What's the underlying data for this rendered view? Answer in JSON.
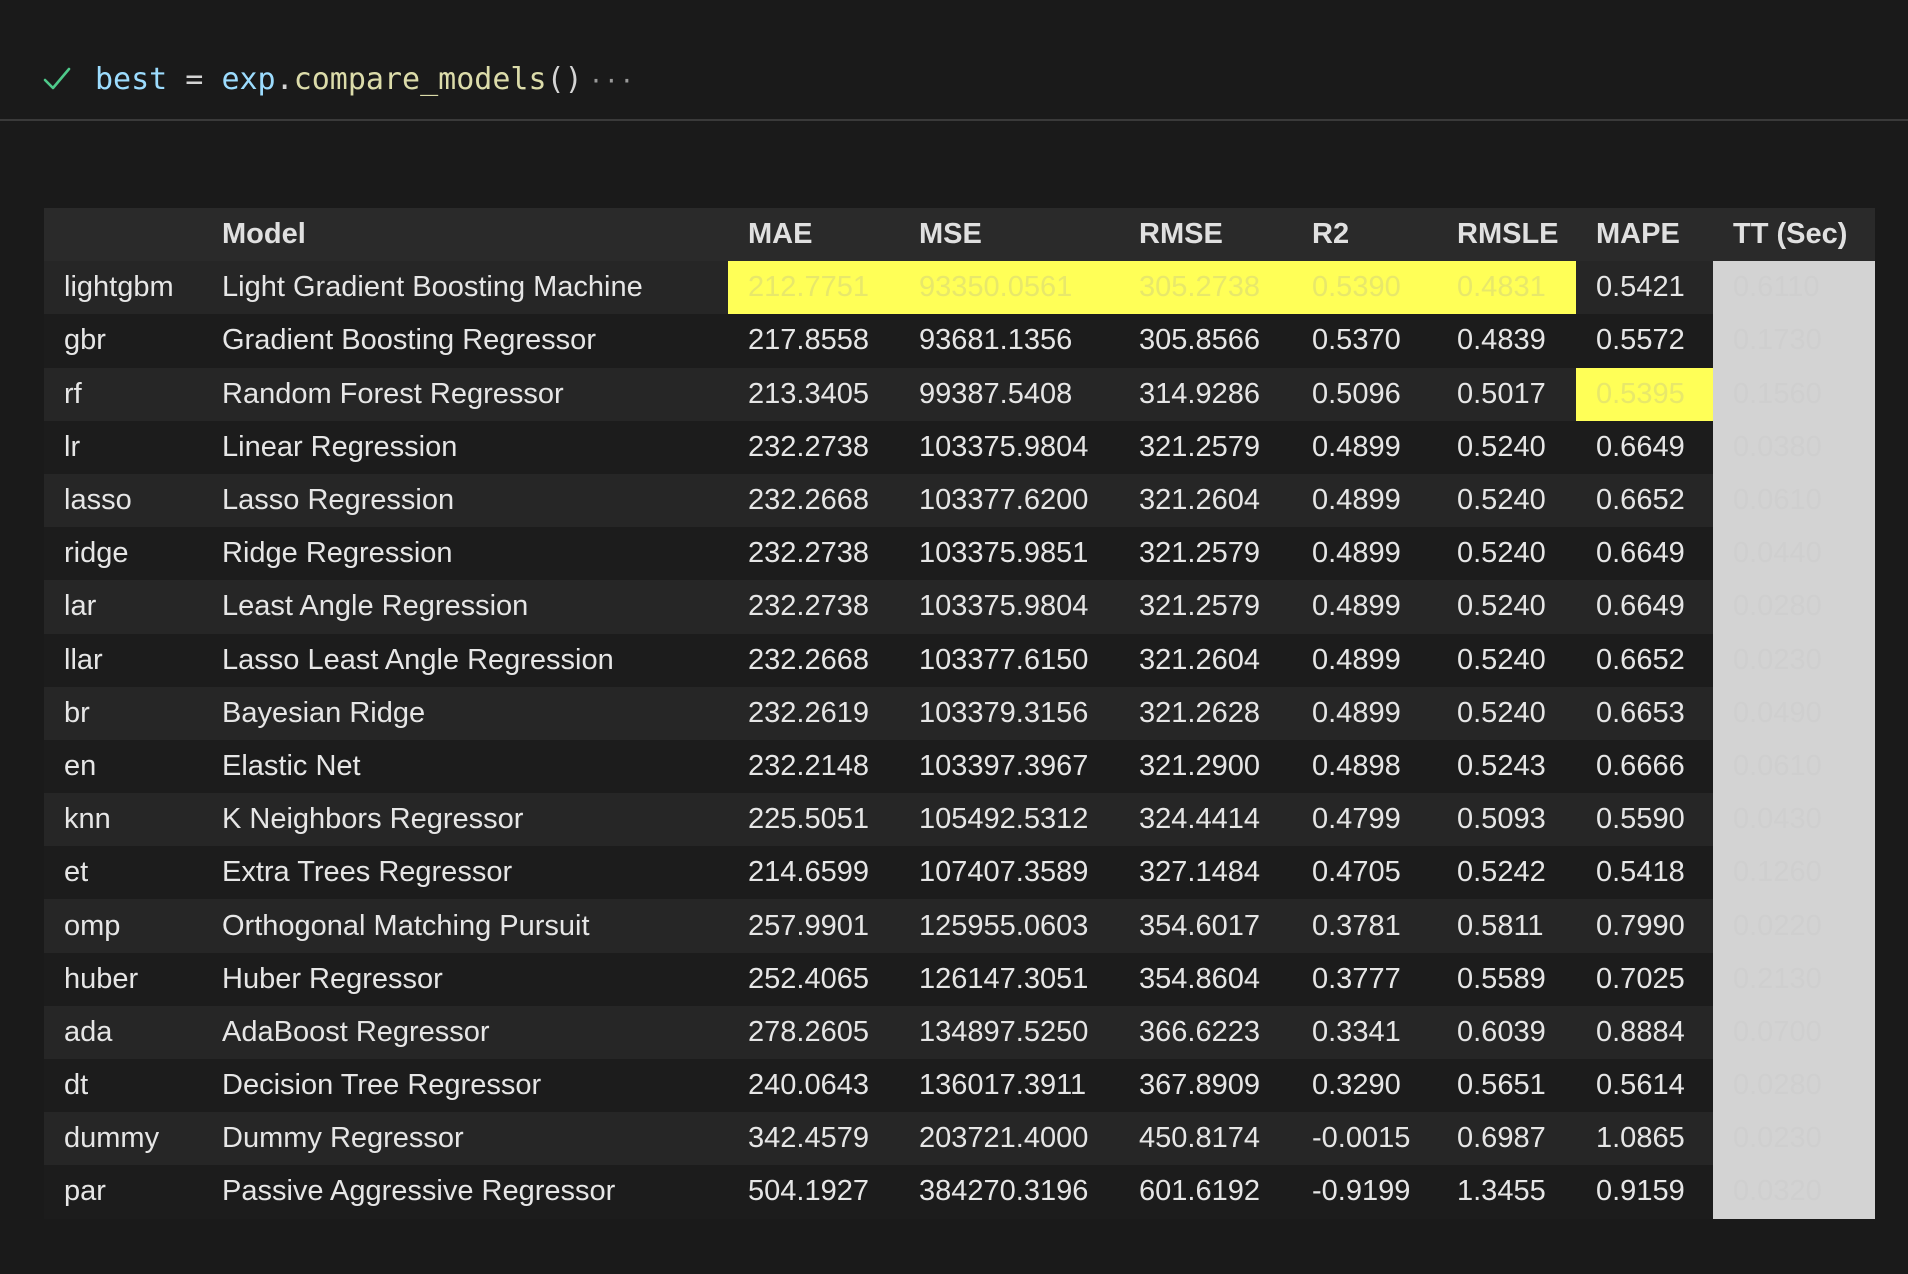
{
  "cell": {
    "status_icon": "checkmark-icon",
    "code": {
      "var": "best",
      "op": " = ",
      "obj": "exp",
      "dot": ".",
      "fn": "compare_models",
      "parens": "()"
    },
    "more": "···"
  },
  "table": {
    "columns": [
      "",
      "Model",
      "MAE",
      "MSE",
      "RMSE",
      "R2",
      "RMSLE",
      "MAPE",
      "TT (Sec)"
    ],
    "highlight_color": "#ffff57",
    "tt_column_color": "#d3d3d3",
    "rows": [
      [
        "lightgbm",
        "Light Gradient Boosting Machine",
        "212.7751",
        "93350.0561",
        "305.2738",
        "0.5390",
        "0.4831",
        "0.5421",
        "0.6110"
      ],
      [
        "gbr",
        "Gradient Boosting Regressor",
        "217.8558",
        "93681.1356",
        "305.8566",
        "0.5370",
        "0.4839",
        "0.5572",
        "0.1730"
      ],
      [
        "rf",
        "Random Forest Regressor",
        "213.3405",
        "99387.5408",
        "314.9286",
        "0.5096",
        "0.5017",
        "0.5395",
        "0.1560"
      ],
      [
        "lr",
        "Linear Regression",
        "232.2738",
        "103375.9804",
        "321.2579",
        "0.4899",
        "0.5240",
        "0.6649",
        "0.0380"
      ],
      [
        "lasso",
        "Lasso Regression",
        "232.2668",
        "103377.6200",
        "321.2604",
        "0.4899",
        "0.5240",
        "0.6652",
        "0.0610"
      ],
      [
        "ridge",
        "Ridge Regression",
        "232.2738",
        "103375.9851",
        "321.2579",
        "0.4899",
        "0.5240",
        "0.6649",
        "0.0440"
      ],
      [
        "lar",
        "Least Angle Regression",
        "232.2738",
        "103375.9804",
        "321.2579",
        "0.4899",
        "0.5240",
        "0.6649",
        "0.0280"
      ],
      [
        "llar",
        "Lasso Least Angle Regression",
        "232.2668",
        "103377.6150",
        "321.2604",
        "0.4899",
        "0.5240",
        "0.6652",
        "0.0230"
      ],
      [
        "br",
        "Bayesian Ridge",
        "232.2619",
        "103379.3156",
        "321.2628",
        "0.4899",
        "0.5240",
        "0.6653",
        "0.0490"
      ],
      [
        "en",
        "Elastic Net",
        "232.2148",
        "103397.3967",
        "321.2900",
        "0.4898",
        "0.5243",
        "0.6666",
        "0.0610"
      ],
      [
        "knn",
        "K Neighbors Regressor",
        "225.5051",
        "105492.5312",
        "324.4414",
        "0.4799",
        "0.5093",
        "0.5590",
        "0.0430"
      ],
      [
        "et",
        "Extra Trees Regressor",
        "214.6599",
        "107407.3589",
        "327.1484",
        "0.4705",
        "0.5242",
        "0.5418",
        "0.1260"
      ],
      [
        "omp",
        "Orthogonal Matching Pursuit",
        "257.9901",
        "125955.0603",
        "354.6017",
        "0.3781",
        "0.5811",
        "0.7990",
        "0.0220"
      ],
      [
        "huber",
        "Huber Regressor",
        "252.4065",
        "126147.3051",
        "354.8604",
        "0.3777",
        "0.5589",
        "0.7025",
        "0.2130"
      ],
      [
        "ada",
        "AdaBoost Regressor",
        "278.2605",
        "134897.5250",
        "366.6223",
        "0.3341",
        "0.6039",
        "0.8884",
        "0.0700"
      ],
      [
        "dt",
        "Decision Tree Regressor",
        "240.0643",
        "136017.3911",
        "367.8909",
        "0.3290",
        "0.5651",
        "0.5614",
        "0.0280"
      ],
      [
        "dummy",
        "Dummy Regressor",
        "342.4579",
        "203721.4000",
        "450.8174",
        "-0.0015",
        "0.6987",
        "1.0865",
        "0.0230"
      ],
      [
        "par",
        "Passive Aggressive Regressor",
        "504.1927",
        "384270.3196",
        "601.6192",
        "-0.9199",
        "1.3455",
        "0.9159",
        "0.0320"
      ]
    ],
    "highlighted": {
      "0": [
        2,
        3,
        4,
        5,
        6
      ],
      "2": [
        7
      ]
    }
  }
}
